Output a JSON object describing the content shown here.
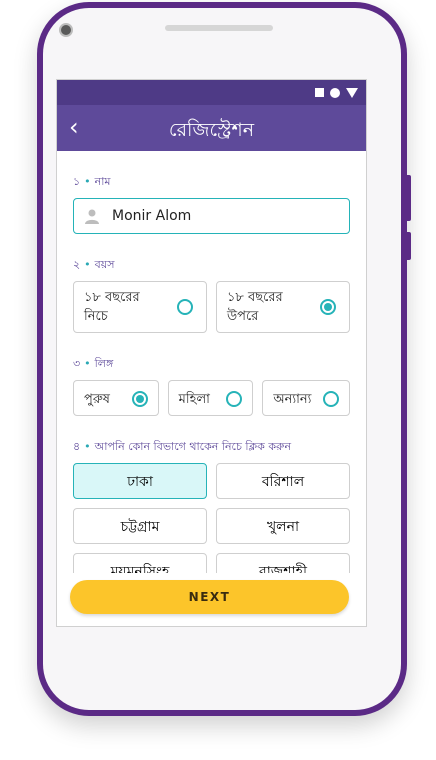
{
  "appbar": {
    "title": "রেজিস্ট্রেশন",
    "back_icon": "chevron-left-icon"
  },
  "status_bar": {
    "icons": [
      "square-icon",
      "circle-icon",
      "triangle-down-icon"
    ]
  },
  "sections": {
    "name": {
      "num": "১",
      "label": "নাম",
      "value": "Monir Alom"
    },
    "age": {
      "num": "২",
      "label": "বয়স",
      "options": [
        {
          "label": "১৮ বছরের নিচে",
          "selected": false
        },
        {
          "label": "১৮ বছরের উপরে",
          "selected": true
        }
      ]
    },
    "gender": {
      "num": "৩",
      "label": "লিঙ্গ",
      "options": [
        {
          "label": "পুরুষ",
          "selected": true
        },
        {
          "label": "মহিলা",
          "selected": false
        },
        {
          "label": "অন্যান্য",
          "selected": false
        }
      ]
    },
    "division": {
      "num": "৪",
      "label": "আপনি কোন বিভাগে থাকেন নিচে ক্লিক করুন",
      "options": [
        "ঢাকা",
        "বরিশাল",
        "চট্টগ্রাম",
        "খুলনা",
        "ময়মনসিংহ",
        "রাজশাহী"
      ],
      "selected": "ঢাকা"
    }
  },
  "next_label": "NEXT",
  "colors": {
    "appbar": "#5e4a9a",
    "accent": "#26b3b8",
    "button": "#fcc52a",
    "frame": "#5b2a86"
  }
}
